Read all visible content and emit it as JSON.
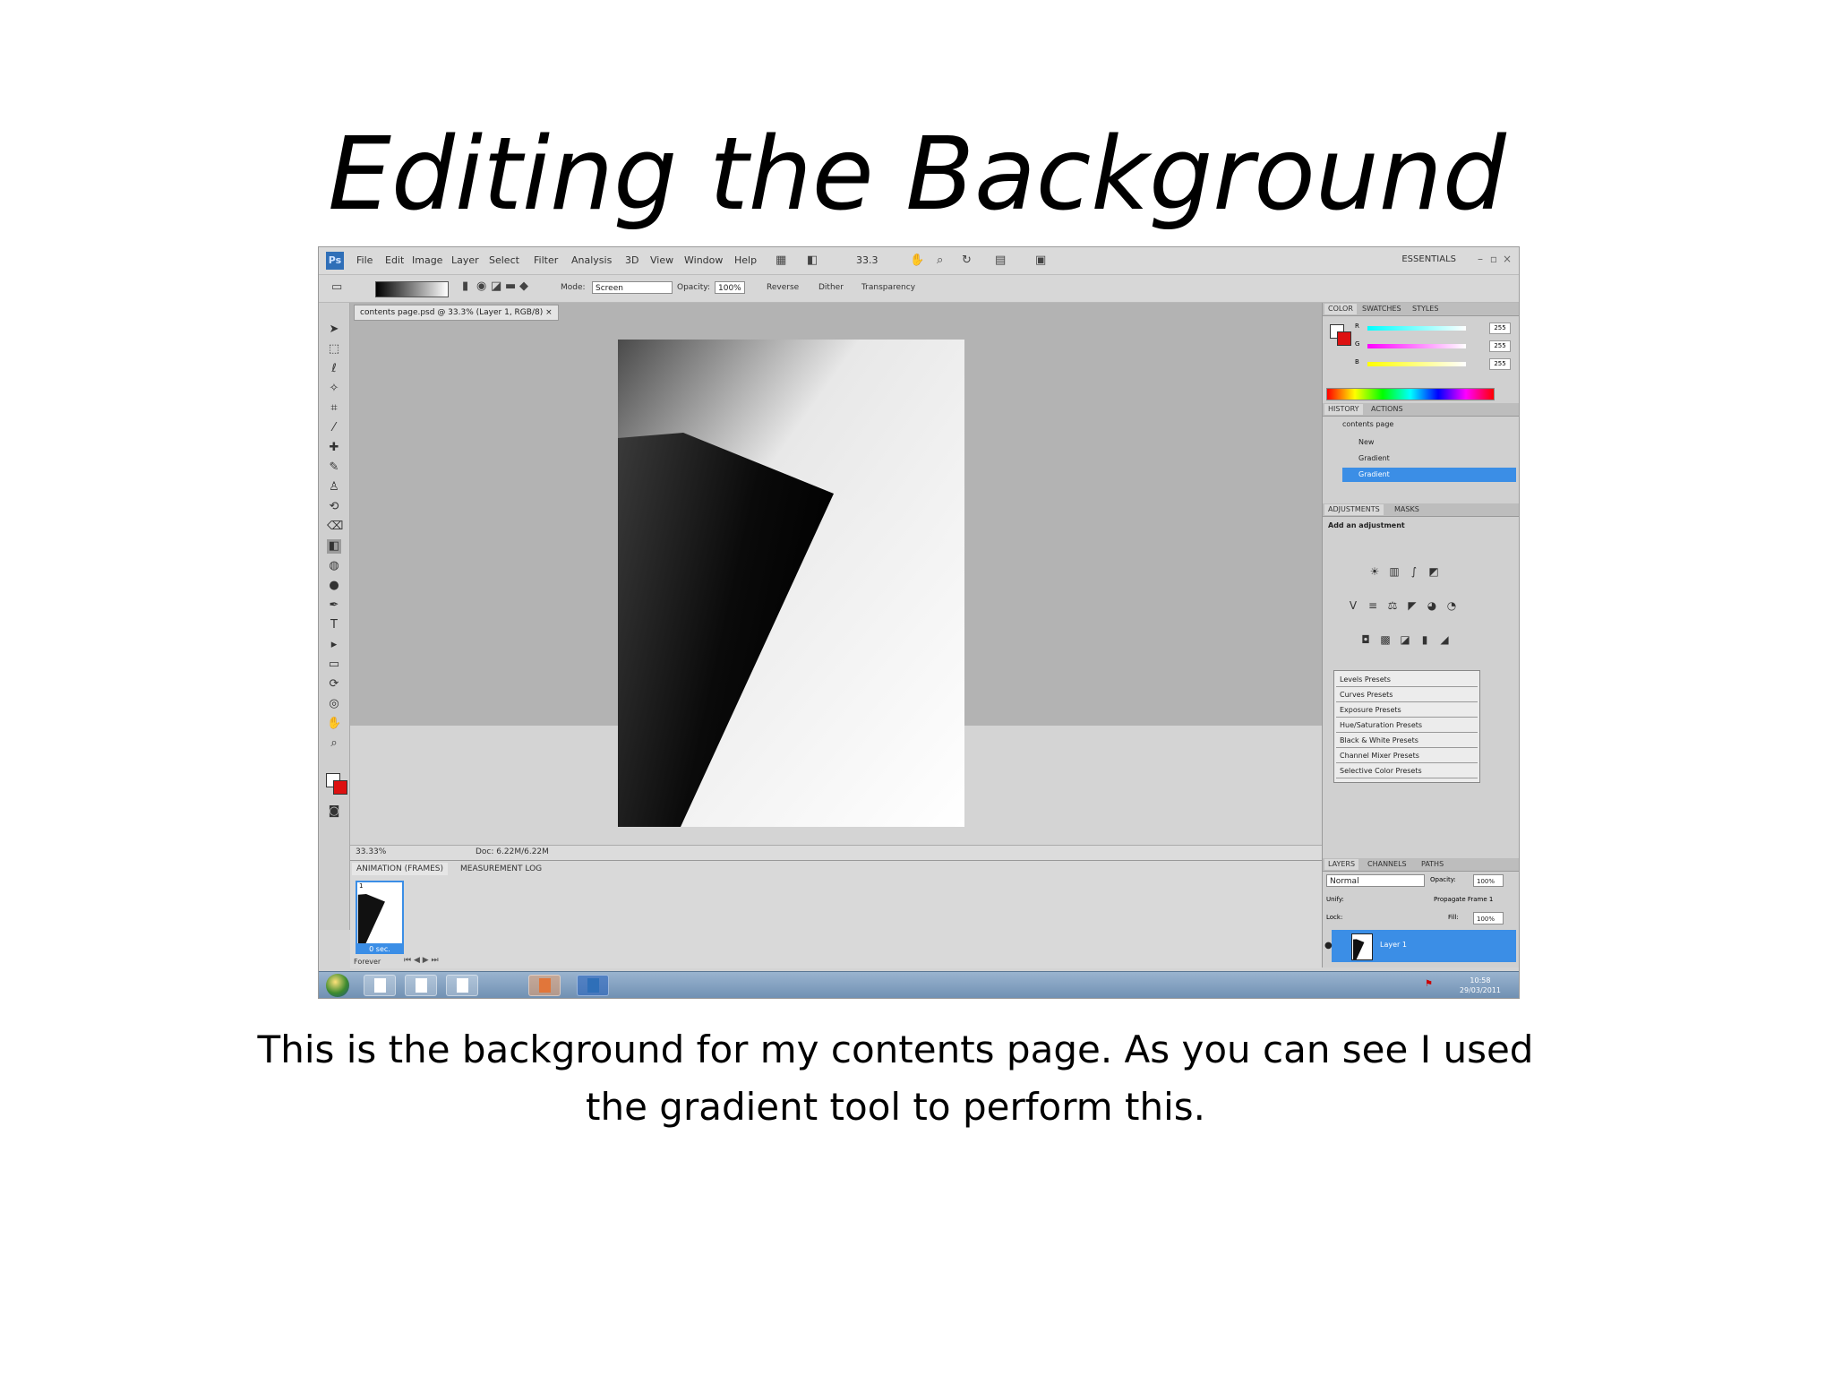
{
  "slide": {
    "title": "Editing the Background",
    "caption": "This is the background for my contents page. As you can see I used the gradient tool to perform this."
  },
  "app": {
    "logo_text": "Ps",
    "menu": [
      "File",
      "Edit",
      "Image",
      "Layer",
      "Select",
      "Filter",
      "Analysis",
      "3D",
      "View",
      "Window",
      "Help"
    ],
    "zoom_dropdown": "33.3",
    "workspace": "ESSENTIALS",
    "options": {
      "mode_label": "Mode:",
      "mode_value": "Screen",
      "opacity_label": "Opacity:",
      "opacity_value": "100%",
      "reverse_label": "Reverse",
      "dither_label": "Dither",
      "transparency_label": "Transparency"
    },
    "document_tab": "contents page.psd @ 33.3% (Layer 1, RGB/8) ×",
    "status": {
      "zoom": "33.33%",
      "doc_size": "Doc: 6.22M/6.22M"
    },
    "animation": {
      "tabs": [
        "ANIMATION (FRAMES)",
        "MEASUREMENT LOG"
      ],
      "frame_number": "1",
      "frame_time": "0 sec.",
      "loop": "Forever"
    },
    "color_panel": {
      "tabs": [
        "COLOR",
        "SWATCHES",
        "STYLES"
      ],
      "channels": [
        {
          "label": "R",
          "value": "255"
        },
        {
          "label": "G",
          "value": "255"
        },
        {
          "label": "B",
          "value": "255"
        }
      ]
    },
    "history_panel": {
      "tabs": [
        "HISTORY",
        "ACTIONS"
      ],
      "snapshot": "contents page",
      "items": [
        "New",
        "Gradient",
        "Gradient"
      ]
    },
    "adjustments_panel": {
      "tabs": [
        "ADJUSTMENTS",
        "MASKS"
      ],
      "heading": "Add an adjustment",
      "presets": [
        "Levels Presets",
        "Curves Presets",
        "Exposure Presets",
        "Hue/Saturation Presets",
        "Black & White Presets",
        "Channel Mixer Presets",
        "Selective Color Presets"
      ]
    },
    "layers_panel": {
      "tabs": [
        "LAYERS",
        "CHANNELS",
        "PATHS"
      ],
      "blend_mode": "Normal",
      "opacity_label": "Opacity:",
      "opacity_value": "100%",
      "unify_label": "Unify:",
      "propagate_label": "Propagate Frame 1",
      "lock_label": "Lock:",
      "fill_label": "Fill:",
      "fill_value": "100%",
      "layer_name": "Layer 1"
    },
    "taskbar": {
      "time": "10:58",
      "date": "29/03/2011"
    }
  }
}
